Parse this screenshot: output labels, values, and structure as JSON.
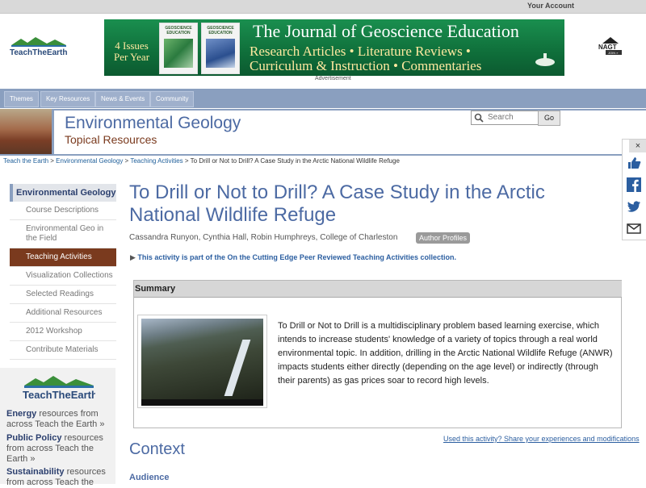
{
  "topbar": {
    "account": "Your Account"
  },
  "banner": {
    "issues": "4 Issues Per Year",
    "cover1": "GEOSCIENCE EDUCATION",
    "cover2": "GEOSCIENCE EDUCATION",
    "title": "The Journal of Geoscience Education",
    "line1": "Research Articles • Literature Reviews •",
    "line2": "Curriculum & Instruction • Commentaries",
    "ad_label": "Advertisement"
  },
  "logos": {
    "tte": "TeachTheEarth",
    "nagt": "NAGT",
    "nagt_join": "JOIN »"
  },
  "nav": {
    "tabs": [
      "Themes",
      "Key Resources",
      "News & Events",
      "Community"
    ]
  },
  "section": {
    "title": "Environmental Geology",
    "subtitle": "Topical Resources"
  },
  "search": {
    "placeholder": "Search",
    "go": "Go"
  },
  "breadcrumb": {
    "items": [
      "Teach the Earth",
      "Environmental Geology",
      "Teaching Activities"
    ],
    "current": "To Drill or Not to Drill? A Case Study in the Arctic National Wildlife Refuge"
  },
  "sidebar": {
    "heading": "Environmental Geology",
    "items": [
      "Course Descriptions",
      "Environmental Geo in the Field",
      "Teaching Activities",
      "Visualization Collections",
      "Selected Readings",
      "Additional Resources",
      "2012 Workshop",
      "Contribute Materials"
    ]
  },
  "promos": [
    {
      "title": "Energy",
      "text": " resources from across Teach the Earth »"
    },
    {
      "title": "Public Policy",
      "text": " resources from across Teach the Earth »"
    },
    {
      "title": "Sustainability",
      "text": " resources from across Teach the"
    }
  ],
  "page": {
    "title": "To Drill or Not to Drill? A Case Study in the Arctic National Wildlife Refuge",
    "authors": "Cassandra Runyon, Cynthia Hall, Robin Humphreys, College of Charleston",
    "author_profiles": "Author Profiles",
    "cutting_edge": "This activity is part of the On the Cutting Edge Peer Reviewed Teaching Activities collection."
  },
  "summary": {
    "heading": "Summary",
    "text": "To Drill or Not to Drill is a multidisciplinary problem based learning exercise, which intends to increase students' knowledge of a variety of topics through a real world environmental topic. In addition, drilling in the Arctic National Wildlife Refuge (ANWR) impacts students either directly (depending on the age level) or indirectly (through their parents) as gas prices soar to record high levels."
  },
  "feedback": {
    "link": "Used this activity? Share your experiences and modifications"
  },
  "context": {
    "heading": "Context",
    "audience": "Audience"
  },
  "share": {
    "close": "×"
  }
}
